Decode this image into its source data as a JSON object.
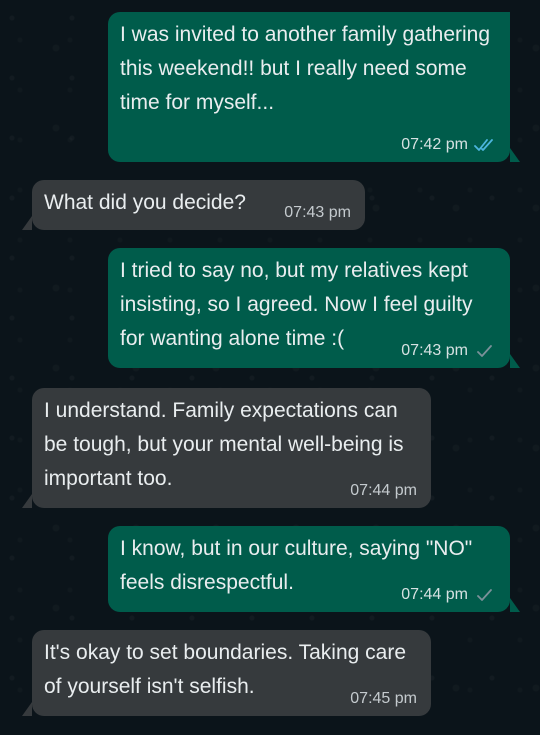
{
  "messages": [
    {
      "direction": "out",
      "text": "I was invited to another family gathering this weekend!! but I really need some time for myself...",
      "time": "07:42 pm",
      "status": "read",
      "status_icon": "double-check-read-icon",
      "status_color": "#53bdeb"
    },
    {
      "direction": "in",
      "text": "What did you decide?",
      "time": "07:43 pm"
    },
    {
      "direction": "out",
      "text": "I tried to say no, but my relatives kept insisting, so I agreed. Now I feel guilty for wanting alone time :(",
      "time": "07:43 pm",
      "status": "sent",
      "status_icon": "single-check-icon",
      "status_color": "#8696a0"
    },
    {
      "direction": "in",
      "text": "I understand. Family expectations can be tough, but your mental well-being is important too.",
      "time": "07:44 pm"
    },
    {
      "direction": "out",
      "text": "I know, but in our culture, saying \"NO\" feels disrespectful.",
      "time": "07:44 pm",
      "status": "sent",
      "status_icon": "single-check-icon",
      "status_color": "#8696a0"
    },
    {
      "direction": "in",
      "text": "It's okay to set boundaries. Taking care of yourself isn't selfish.",
      "time": "07:45 pm"
    }
  ],
  "colors": {
    "background": "#0b141a",
    "outgoing_bubble": "#005c4b",
    "incoming_bubble": "#363a3d",
    "text": "#e9edef"
  }
}
